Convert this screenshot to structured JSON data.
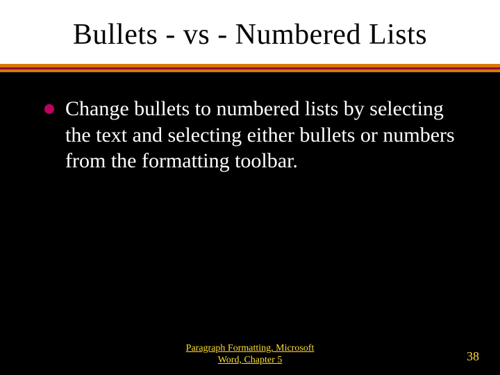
{
  "title": "Bullets - vs - Numbered Lists",
  "bullets": [
    "Change bullets to numbered lists by selecting the text and selecting either bullets or numbers from the formatting toolbar."
  ],
  "footer": {
    "center_line1": "Paragraph Formatting, Microsoft",
    "center_line2": "Word, Chapter 5",
    "page_number": "38"
  },
  "colors": {
    "bullet": "#c00060",
    "divider": "#d87a00",
    "footer_text": "#ffdd33",
    "background": "#000000",
    "title_bg": "#ffffff"
  }
}
